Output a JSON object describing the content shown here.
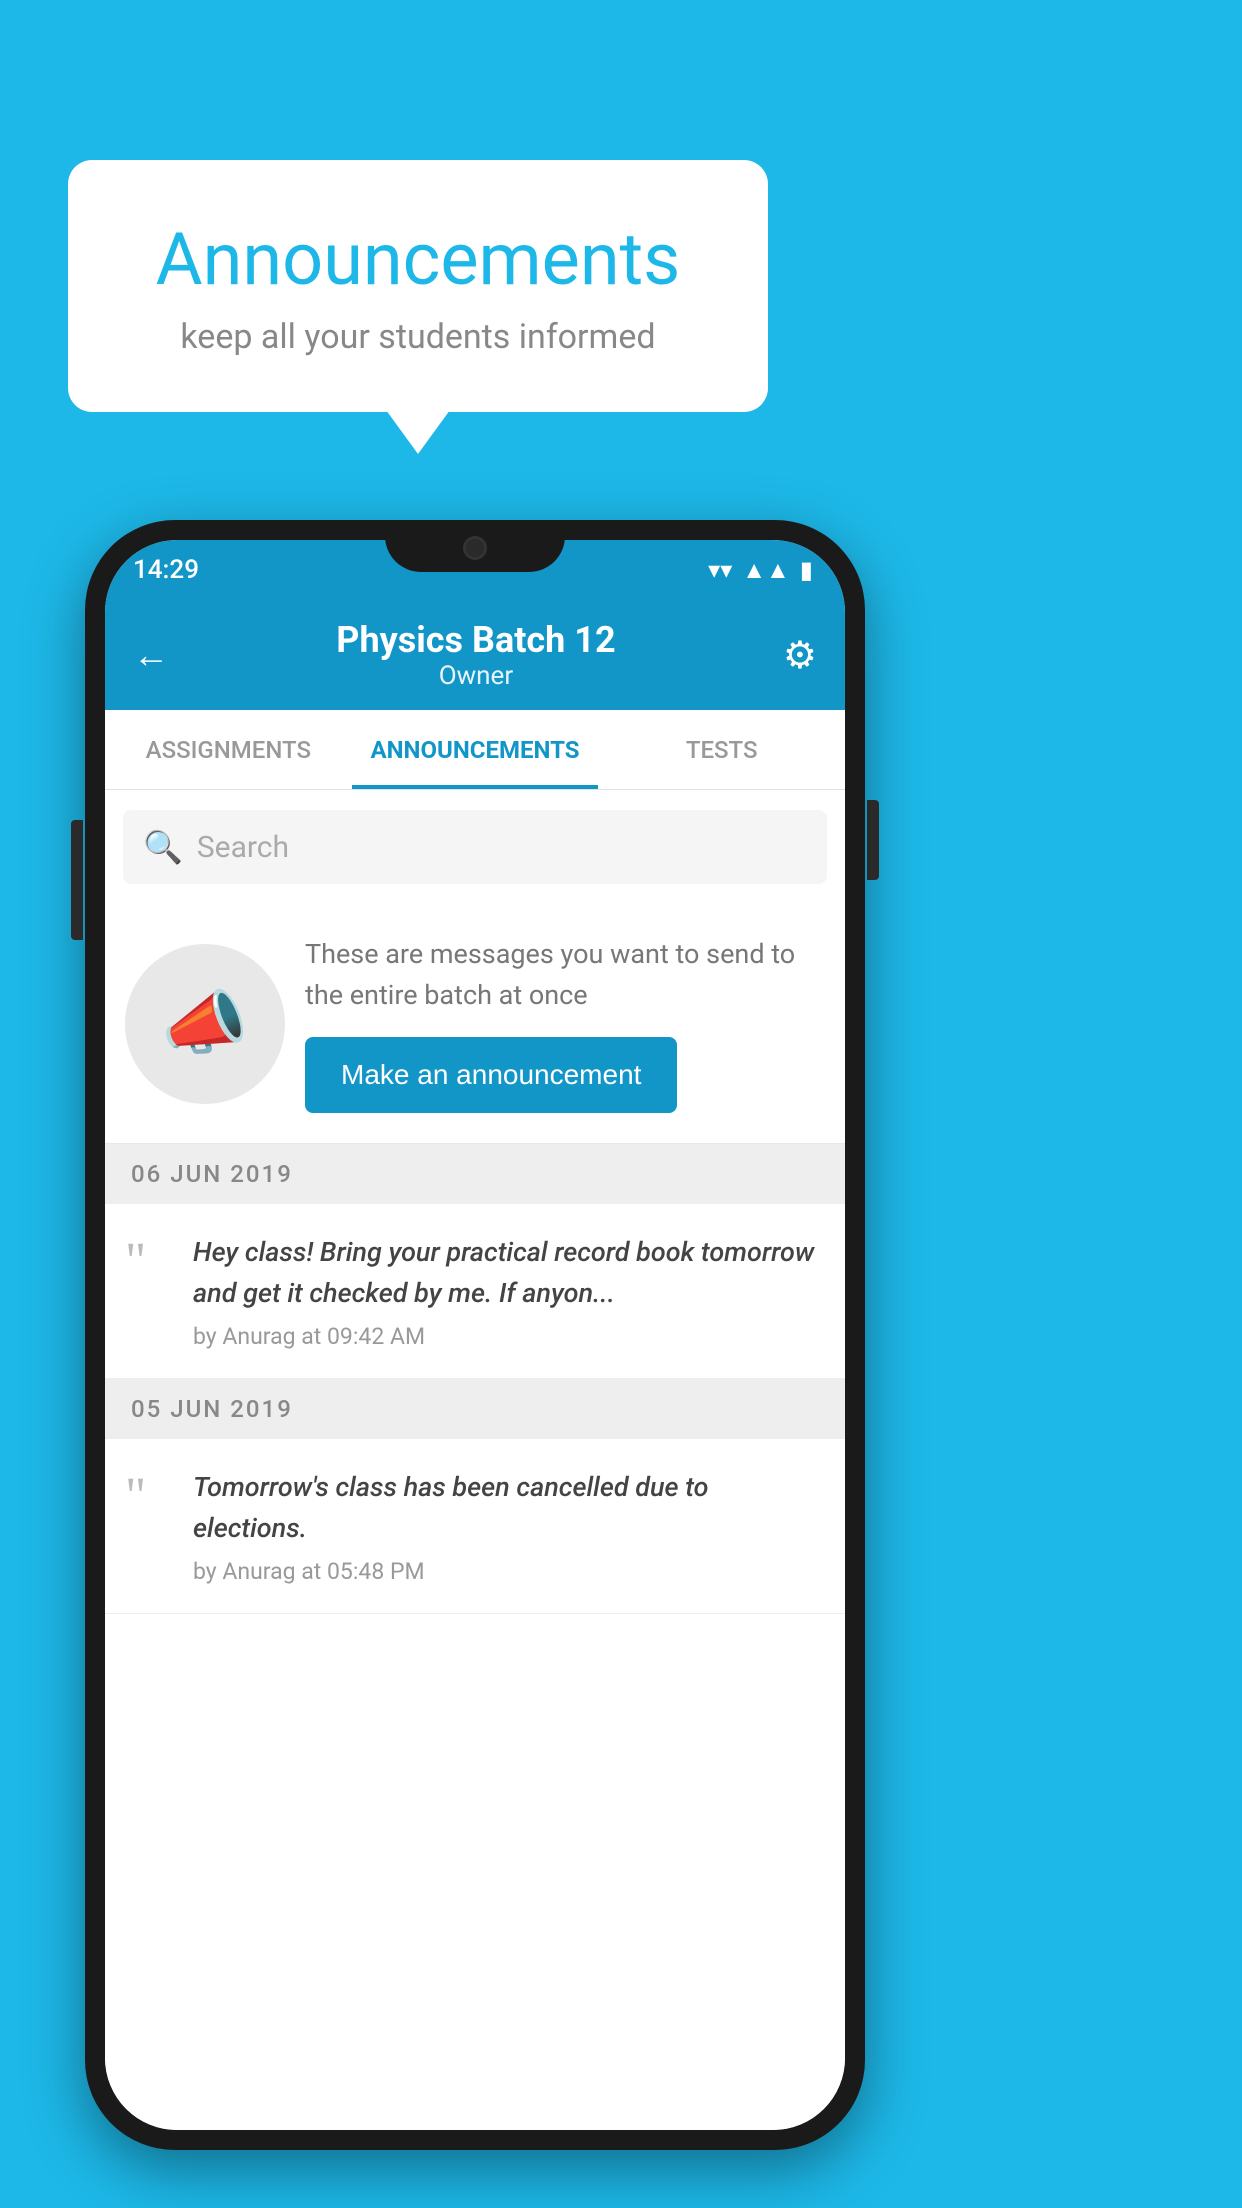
{
  "background_color": "#1DB8E8",
  "speech_bubble": {
    "title": "Announcements",
    "subtitle": "keep all your students informed"
  },
  "phone": {
    "status_bar": {
      "time": "14:29",
      "icons": [
        "wifi",
        "signal",
        "battery"
      ]
    },
    "header": {
      "back_label": "←",
      "title": "Physics Batch 12",
      "subtitle": "Owner",
      "settings_label": "⚙"
    },
    "tabs": [
      {
        "label": "ASSIGNMENTS",
        "active": false
      },
      {
        "label": "ANNOUNCEMENTS",
        "active": true
      },
      {
        "label": "TESTS",
        "active": false
      }
    ],
    "search": {
      "placeholder": "Search"
    },
    "promo": {
      "description": "These are messages you want to send to the entire batch at once",
      "button_label": "Make an announcement"
    },
    "announcements": [
      {
        "date": "06  JUN  2019",
        "message": "Hey class! Bring your practical record book tomorrow and get it checked by me. If anyon...",
        "meta": "by Anurag at 09:42 AM"
      },
      {
        "date": "05  JUN  2019",
        "message": "Tomorrow's class has been cancelled due to elections.",
        "meta": "by Anurag at 05:48 PM"
      }
    ]
  }
}
